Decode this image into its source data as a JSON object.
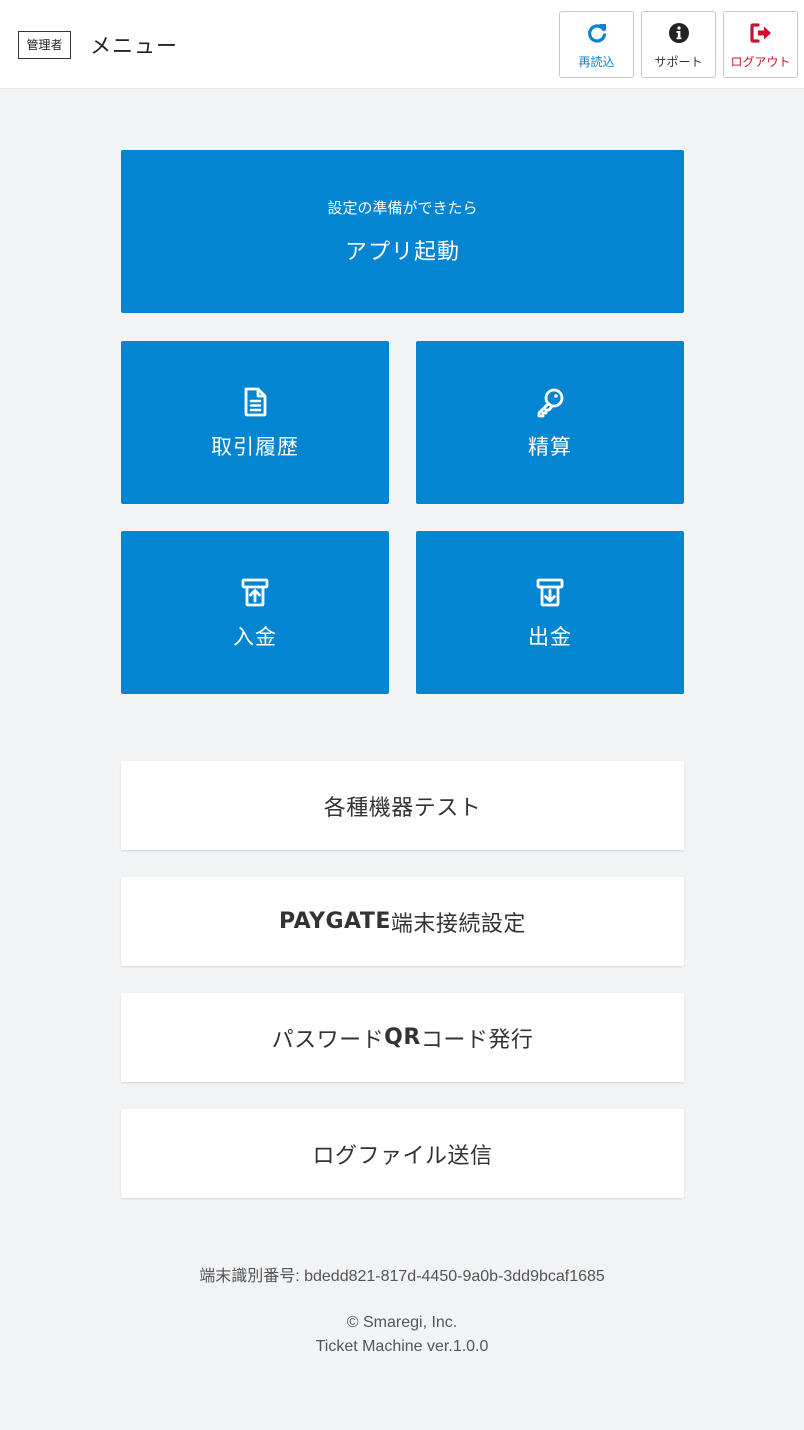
{
  "header": {
    "role_badge": "管理者",
    "title": "メニュー",
    "buttons": [
      {
        "label": "再読込",
        "icon": "reload-icon",
        "color": "#0a82d0"
      },
      {
        "label": "サポート",
        "icon": "info-icon",
        "color": "#222222"
      },
      {
        "label": "ログアウト",
        "icon": "logout-icon",
        "color": "#c8102e"
      }
    ]
  },
  "launch": {
    "subtitle": "設定の準備ができたら",
    "label": "アプリ起動"
  },
  "tiles": [
    {
      "label": "取引履歴",
      "icon": "document-icon"
    },
    {
      "label": "精算",
      "icon": "key-icon"
    },
    {
      "label": "入金",
      "icon": "cash-in-icon"
    },
    {
      "label": "出金",
      "icon": "cash-out-icon"
    }
  ],
  "menu": {
    "device_test": "各種機器テスト",
    "paygate_bold": "PAYGATE",
    "paygate_rest": "端末接続設定",
    "qr_pre": "パスワード",
    "qr_bold": "QR",
    "qr_post": "コード発行",
    "log_send": "ログファイル送信"
  },
  "footer": {
    "device_id_label": "端末識別番号",
    "device_id_value": ": bdedd821-817d-4450-9a0b-3dd9bcaf1685",
    "copyright": "© Smaregi, Inc.",
    "version": "Ticket Machine ver.1.0.0"
  },
  "colors": {
    "accent": "#0385d1",
    "background": "#f2f3f5",
    "logout": "#c8102e"
  }
}
